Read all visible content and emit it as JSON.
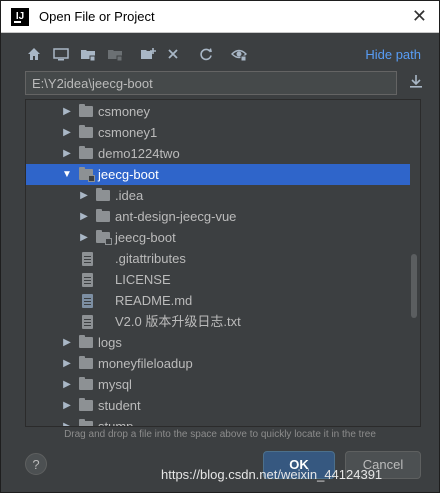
{
  "window": {
    "title": "Open File or Project",
    "logo_text": "IJ",
    "close_glyph": "✕"
  },
  "toolbar": {
    "icons": [
      "home-icon",
      "desktop-icon",
      "project-folder-icon",
      "module-folder-icon",
      "new-folder-icon",
      "delete-icon",
      "refresh-icon",
      "show-hidden-icon"
    ],
    "hide_path_label": "Hide path"
  },
  "path": {
    "value": "E:\\Y2idea\\jeecg-boot"
  },
  "tree": {
    "rows": [
      {
        "label": "csmoney",
        "kind": "folder",
        "expanded": false
      },
      {
        "label": "csmoney1",
        "kind": "folder",
        "expanded": false
      },
      {
        "label": "demo1224two",
        "kind": "folder",
        "expanded": false
      },
      {
        "label": "jeecg-boot",
        "kind": "module-folder",
        "expanded": true,
        "selected": true
      },
      {
        "label": ".idea",
        "kind": "folder",
        "expanded": false
      },
      {
        "label": "ant-design-jeecg-vue",
        "kind": "folder",
        "expanded": false
      },
      {
        "label": "jeecg-boot",
        "kind": "module-folder",
        "expanded": false
      },
      {
        "label": ".gitattributes",
        "kind": "file"
      },
      {
        "label": "LICENSE",
        "kind": "file"
      },
      {
        "label": "README.md",
        "kind": "md-file"
      },
      {
        "label": "V2.0 版本升级日志.txt",
        "kind": "file"
      },
      {
        "label": "logs",
        "kind": "folder",
        "expanded": false
      },
      {
        "label": "moneyfileloadup",
        "kind": "folder",
        "expanded": false
      },
      {
        "label": "mysql",
        "kind": "folder",
        "expanded": false
      },
      {
        "label": "student",
        "kind": "folder",
        "expanded": false
      },
      {
        "label": "stump",
        "kind": "folder",
        "expanded": false
      }
    ]
  },
  "hint": "Drag and drop a file into the space above to quickly locate it in the tree",
  "buttons": {
    "help": "?",
    "ok": "OK",
    "cancel": "Cancel"
  },
  "watermark": "https://blog.csdn.net/weixin_44124391",
  "colors": {
    "background": "#3c3f41",
    "selection": "#2f65ca",
    "link": "#589df6",
    "ok_button": "#365880"
  }
}
